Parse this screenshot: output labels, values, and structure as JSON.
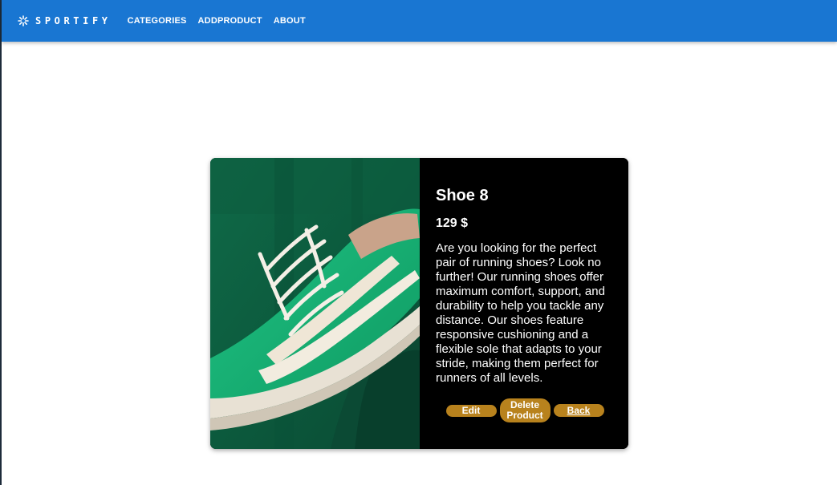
{
  "navbar": {
    "brand": "SPORTIFY",
    "brand_icon": "snowflake-logo-icon",
    "links": [
      "CATEGORIES",
      "ADDPRODUCT",
      "ABOUT"
    ],
    "color": "#1976d2"
  },
  "product": {
    "title": "Shoe 8",
    "price": "129 $",
    "description": "Are you looking for the perfect pair of running shoes? Look no further! Our running shoes offer maximum comfort, support, and durability to help you tackle any distance. Our shoes feature responsive cushioning and a flexible sole that adapts to your stride, making them perfect for runners of all levels.",
    "image": "green-sneaker-image"
  },
  "actions": {
    "edit_label": "Edit",
    "delete_label": "Delete Product",
    "back_label": "Back",
    "button_color": "#b8821d"
  }
}
